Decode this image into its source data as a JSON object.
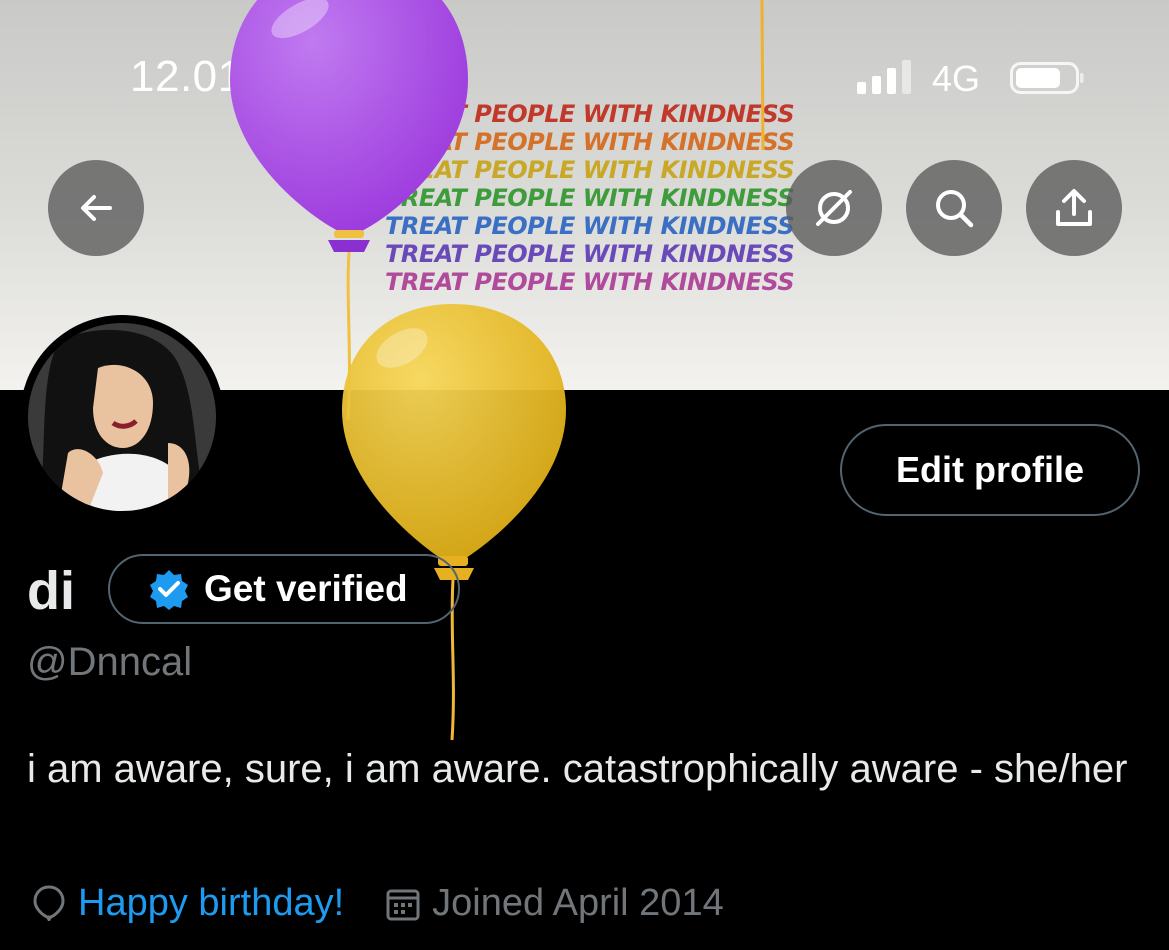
{
  "status_bar": {
    "time": "12.01",
    "network": "4G"
  },
  "banner": {
    "text_lines": [
      {
        "text": "TREAT PEOPLE WITH KINDNESS",
        "color": "#c0392b"
      },
      {
        "text": "TREAT PEOPLE WITH KINDNESS",
        "color": "#d4722b"
      },
      {
        "text": "TREAT PEOPLE WITH KINDNESS",
        "color": "#c9a827"
      },
      {
        "text": "TREAT PEOPLE WITH KINDNESS",
        "color": "#3f9c3c"
      },
      {
        "text": "TREAT PEOPLE WITH KINDNESS",
        "color": "#3b6fc4"
      },
      {
        "text": "TREAT PEOPLE WITH KINDNESS",
        "color": "#6a4ab8"
      },
      {
        "text": "TREAT PEOPLE WITH KINDNESS",
        "color": "#b04a9c"
      }
    ]
  },
  "header_actions": {
    "back": "back-arrow-icon",
    "grok": "grok-icon",
    "search": "search-icon",
    "share": "share-icon"
  },
  "profile": {
    "name": "di",
    "verify_label": "Get verified",
    "handle": "@Dnncal",
    "bio": "i am aware, sure, i am aware. catastrophically aware - she/her",
    "birthday_label": "Happy birthday!",
    "joined": "Joined April 2014",
    "edit_label": "Edit profile"
  },
  "colors": {
    "accent": "#1d9bf0",
    "secondary_text": "#71767b",
    "balloon_purple": "#a646e0",
    "balloon_yellow": "#f2c230"
  }
}
